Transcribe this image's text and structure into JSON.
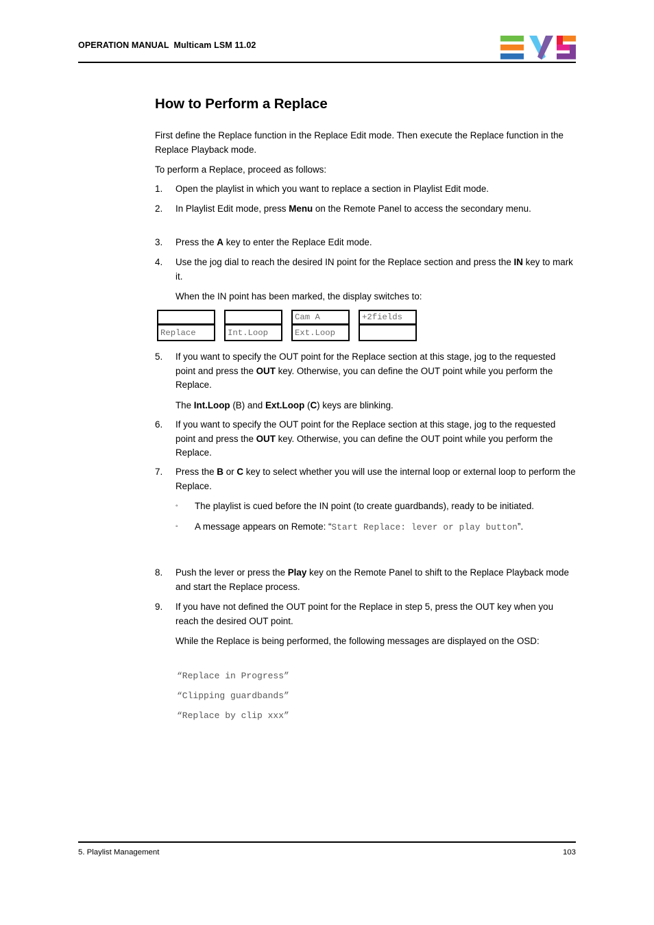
{
  "header": {
    "title": "OPERATION MANUAL  Multicam LSM 11.02",
    "logo_alt": "EVS",
    "logo_colors": {
      "green": "#6cbe45",
      "orange": "#f5821f",
      "blue": "#2d71b8",
      "cyan": "#5bc5f2",
      "purple": "#7b5aa6",
      "red": "#ed1c3a",
      "magenta": "#e6218c",
      "violet": "#7f3f98",
      "orange_top": "#f5821f"
    }
  },
  "doc": {
    "title": "How to Perform a Replace",
    "intro_1": "First define the Replace function in the Replace Edit mode. Then execute the Replace function in the Replace Playback mode.",
    "intro_2": "To perform a Replace, proceed as follows:"
  },
  "steps": {
    "s1": {
      "num": "1.",
      "text": "Open the playlist in which you want to replace a section in Playlist Edit mode."
    },
    "s2": {
      "num": "2.",
      "pre": "In Playlist Edit mode, press ",
      "bold": "Menu",
      "post": " on the Remote Panel to access the secondary menu."
    },
    "s3": {
      "num": "3.",
      "pre": "Press the ",
      "bold": "A",
      "post": " key to enter the Replace Edit mode."
    },
    "s4": {
      "num": "4.",
      "pre": "Use the jog dial to reach the desired IN point for the Replace section and press the ",
      "bold": "IN",
      "post": " key to mark it.",
      "sub": "When the IN point has been marked, the display switches to:"
    },
    "s5": {
      "num": "5.",
      "pre": "If you want to specify the OUT point for the Replace section at this stage, jog to the requested point and press the ",
      "bold": "OUT",
      "post": " key. Otherwise, you can define the OUT point while you perform the Replace.",
      "sub_a": "The ",
      "sub_b1": "Int.Loop",
      "sub_c": " (B) and ",
      "sub_b2": "Ext.Loop",
      "sub_d": " (",
      "sub_b3": "C",
      "sub_e": ") keys are blinking."
    },
    "s6": {
      "num": "6.",
      "pre": "If you want to specify the OUT point for the Replace section at this stage, jog to the requested point and press the ",
      "bold": "OUT",
      "post": " key. Otherwise, you can define the OUT point while you perform the Replace."
    },
    "s7": {
      "num": "7.",
      "pre": "Press the ",
      "bold1": "B",
      "mid": " or ",
      "bold2": "C",
      "post": " key to select whether you will use the internal loop or external loop to perform the Replace.",
      "bullets": [
        {
          "mark": "◦",
          "text": "The playlist is cued before the IN point (to create guardbands), ready to be initiated."
        },
        {
          "mark": "◦",
          "pre": "A message appears on Remote: “",
          "mono": "Start Replace: lever or play button",
          "post": "”."
        }
      ]
    },
    "s8": {
      "num": "8.",
      "pre": "Push the lever or press the ",
      "bold": "Play",
      "post": " key on the Remote Panel to shift to the Replace Playback mode and start the Replace process."
    },
    "s9": {
      "num": "9.",
      "text": "If you have not defined the OUT point for the Replace in step 5, press the OUT key when you reach the desired OUT point.",
      "sub": "While the Replace is being performed, the following messages are displayed on the OSD:"
    }
  },
  "keyboxes": [
    {
      "top": "",
      "bottom": "Replace"
    },
    {
      "top": "",
      "bottom": "Int.Loop"
    },
    {
      "top": "Cam A",
      "bottom": "Ext.Loop"
    },
    {
      "top": "+2fields",
      "bottom": ""
    }
  ],
  "osd_messages": [
    "“Replace in Progress”",
    "“Clipping guardbands”",
    "“Replace by clip xxx”"
  ],
  "footer": {
    "section": "5. Playlist Management",
    "page": "103"
  }
}
